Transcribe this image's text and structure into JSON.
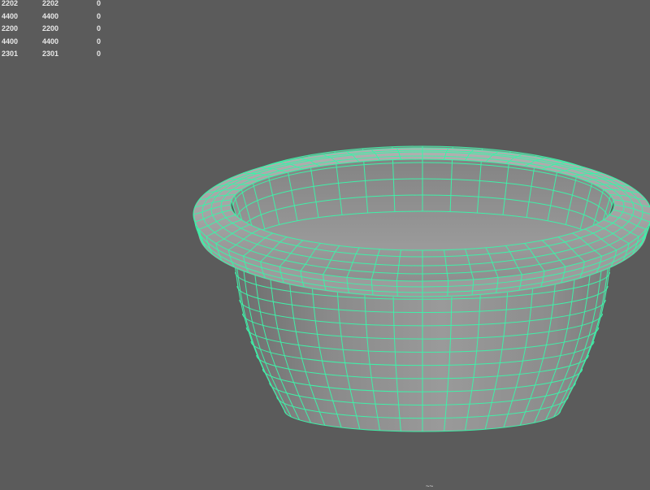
{
  "hud": {
    "rows": [
      [
        "2202",
        "2202",
        "0"
      ],
      [
        "4400",
        "4400",
        "0"
      ],
      [
        "2200",
        "2200",
        "0"
      ],
      [
        "4400",
        "4400",
        "0"
      ],
      [
        "2301",
        "2301",
        "0"
      ]
    ]
  },
  "viewport": {
    "object": "bowl",
    "background_color": "#5b5b5b",
    "wireframe_color": "#3ff0a8",
    "bottom_label": "~~"
  }
}
